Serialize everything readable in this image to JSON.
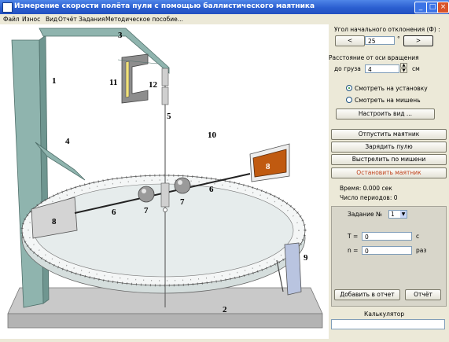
{
  "window": {
    "title": "Измерение скорости полёта пули с помощью баллистического маятника"
  },
  "menu": [
    "Файл",
    "Износ",
    "Вид",
    "Отчёт",
    "Задания",
    "Методическое пособие..."
  ],
  "scene": {
    "callouts": [
      "1",
      "2",
      "3",
      "4",
      "5",
      "6",
      "6",
      "7",
      "7",
      "8",
      "8",
      "9",
      "10",
      "11",
      "12"
    ]
  },
  "panel": {
    "angle_label": "Угол начального отклонения (Ф) :",
    "angle_value": "25",
    "angle_unit": "°",
    "dec_btn": "<",
    "inc_btn": ">",
    "distance_label": "Расстояние от оси вращения",
    "distance_to": "до груза",
    "distance_value": "4",
    "distance_unit": "см",
    "radio_setup": "Смотреть на установку",
    "radio_target": "Смотреть на мишень",
    "btn_view": "Настроить вид ...",
    "btn_release": "Отпустить маятник",
    "btn_load": "Зарядить пулю",
    "btn_fire": "Выстрелить по мишени",
    "btn_stop": "Остановить маятник",
    "time_text": "Время: 0.000 сек",
    "periods_text": "Число периодов: 0",
    "task_label": "Задание №",
    "task_value": "1",
    "T_label": "T =",
    "T_value": "0",
    "T_unit": "с",
    "n_label": "n =",
    "n_value": "0",
    "n_unit": "раз",
    "btn_add": "Добавить в отчет",
    "btn_report": "Отчёт",
    "calc_label": "Калькулятор"
  },
  "colors": {
    "stand": "#8fb4ae",
    "base": "#c9c9c9",
    "target": "#c05a10",
    "disk": "#f4f6f6"
  }
}
